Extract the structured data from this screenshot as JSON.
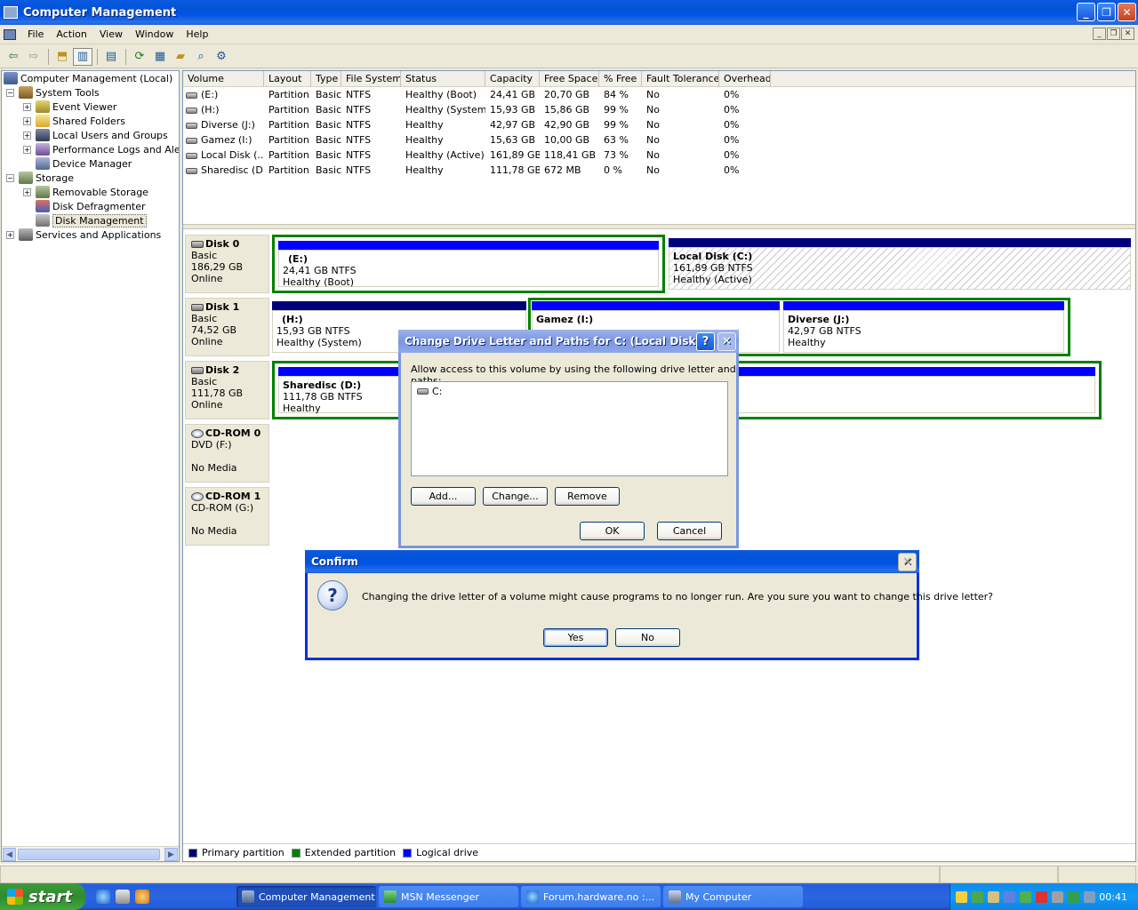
{
  "window": {
    "title": "Computer Management"
  },
  "menu": [
    "File",
    "Action",
    "View",
    "Window",
    "Help"
  ],
  "toolbar_icons": [
    "back-icon",
    "forward-icon",
    "up-icon",
    "show-hide-tree-icon",
    "properties-icon",
    "refresh-icon",
    "export-icon",
    "open-icon",
    "search-icon",
    "settings-icon"
  ],
  "tree": {
    "root": "Computer Management (Local)",
    "system_tools": "System Tools",
    "event_viewer": "Event Viewer",
    "shared_folders": "Shared Folders",
    "local_users": "Local Users and Groups",
    "perf_logs": "Performance Logs and Alerts",
    "device_manager": "Device Manager",
    "storage": "Storage",
    "removable_storage": "Removable Storage",
    "disk_defrag": "Disk Defragmenter",
    "disk_management": "Disk Management",
    "services": "Services and Applications"
  },
  "volumes": {
    "columns": [
      "Volume",
      "Layout",
      "Type",
      "File System",
      "Status",
      "Capacity",
      "Free Space",
      "% Free",
      "Fault Tolerance",
      "Overhead"
    ],
    "rows": [
      [
        "(E:)",
        "Partition",
        "Basic",
        "NTFS",
        "Healthy (Boot)",
        "24,41 GB",
        "20,70 GB",
        "84 %",
        "No",
        "0%"
      ],
      [
        "(H:)",
        "Partition",
        "Basic",
        "NTFS",
        "Healthy (System)",
        "15,93 GB",
        "15,86 GB",
        "99 %",
        "No",
        "0%"
      ],
      [
        "Diverse (J:)",
        "Partition",
        "Basic",
        "NTFS",
        "Healthy",
        "42,97 GB",
        "42,90 GB",
        "99 %",
        "No",
        "0%"
      ],
      [
        "Gamez (I:)",
        "Partition",
        "Basic",
        "NTFS",
        "Healthy",
        "15,63 GB",
        "10,00 GB",
        "63 %",
        "No",
        "0%"
      ],
      [
        "Local Disk  (...",
        "Partition",
        "Basic",
        "NTFS",
        "Healthy (Active)",
        "161,89 GB",
        "118,41 GB",
        "73 %",
        "No",
        "0%"
      ],
      [
        "Sharedisc (D:)",
        "Partition",
        "Basic",
        "NTFS",
        "Healthy",
        "111,78 GB",
        "672 MB",
        "0 %",
        "No",
        "0%"
      ]
    ]
  },
  "disks": {
    "disk0": {
      "name": "Disk 0",
      "type": "Basic",
      "size": "186,29 GB",
      "state": "Online",
      "p1": {
        "name": "(E:)",
        "size": "24,41 GB NTFS",
        "status": "Healthy (Boot)"
      },
      "p2": {
        "name": "Local Disk  (C:)",
        "size": "161,89 GB NTFS",
        "status": "Healthy (Active)"
      }
    },
    "disk1": {
      "name": "Disk 1",
      "type": "Basic",
      "size": "74,52 GB",
      "state": "Online",
      "p1": {
        "name": "(H:)",
        "size": "15,93 GB NTFS",
        "status": "Healthy (System)"
      },
      "p2": {
        "name": "Gamez  (I:)"
      },
      "p3": {
        "name": "Diverse  (J:)",
        "size": "42,97 GB NTFS",
        "status": "Healthy"
      }
    },
    "disk2": {
      "name": "Disk 2",
      "type": "Basic",
      "size": "111,78 GB",
      "state": "Online",
      "p1": {
        "name": "Sharedisc  (D:)",
        "size": "111,78 GB NTFS",
        "status": "Healthy"
      }
    },
    "cdrom0": {
      "name": "CD-ROM 0",
      "type": "DVD (F:)",
      "state": "No Media"
    },
    "cdrom1": {
      "name": "CD-ROM 1",
      "type": "CD-ROM (G:)",
      "state": "No Media"
    }
  },
  "legend": [
    "Primary partition",
    "Extended partition",
    "Logical drive"
  ],
  "colors": {
    "primary": "#00007A",
    "extended": "#008000",
    "logical": "#0000FF"
  },
  "change_dialog": {
    "title": "Change Drive Letter and Paths for C: (Local Disk )",
    "instruction": "Allow access to this volume by using the following drive letter and paths:",
    "path": "C:",
    "add": "Add...",
    "change": "Change...",
    "remove": "Remove",
    "ok": "OK",
    "cancel": "Cancel"
  },
  "confirm_dialog": {
    "title": "Confirm",
    "message": "Changing the drive letter of a volume might cause programs to no longer run. Are you sure you want to change this drive letter?",
    "yes": "Yes",
    "no": "No"
  },
  "taskbar": {
    "start": "start",
    "tasks": [
      "Computer Management",
      "MSN Messenger",
      "Forum.hardware.no :...",
      "My Computer"
    ],
    "clock": "00:41"
  }
}
